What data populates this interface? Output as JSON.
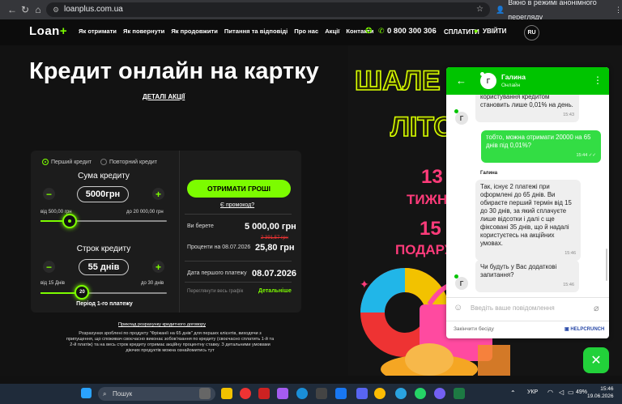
{
  "browser": {
    "url": "loanplus.com.ua",
    "incognito_label": "Вікно в режимі анонімного перегляду"
  },
  "nav": {
    "logo": "Loan",
    "links": [
      "Як отримати",
      "Як повернути",
      "Як продовжити",
      "Питання та відповіді",
      "Про нас",
      "Акції",
      "Контакти"
    ],
    "phone": "0 800 300 306",
    "pay": "СПЛАТИТИ",
    "login": "УВІЙТИ",
    "lang": "RU"
  },
  "hero": {
    "title": "Кредит онлайн на картку",
    "deals_link": "ДЕТАЛІ АКЦІЇ"
  },
  "calculator": {
    "radio_first": "Перший кредит",
    "radio_repeat": "Повторний кредит",
    "amount_label": "Сума кредиту",
    "amount_value": "5000грн",
    "amount_min": "від 500,00 грн",
    "amount_max": "до 20 000,00 грн",
    "amount_fraction": 0.23,
    "term_label": "Строк кредиту",
    "term_value": "55 днів",
    "term_min": "від 15 Днів",
    "term_max": "до 30 днів",
    "term_knob": "20",
    "term_fraction": 0.33,
    "period_label": "Період 1-го платежу",
    "get_money": "ОТРИМАТИ ГРОШІ",
    "promo_code": "Є промокод?",
    "borrow_label": "Ви берете",
    "borrow_value": "5 000,00 грн",
    "interest_old": "2 391,57 грн",
    "interest_label": "Проценти на 08.07.2026",
    "interest_value": "25,80 грн",
    "first_payment_label": "Дата першого платежу",
    "first_payment_value": "08.07.2026",
    "schedule_label": "Переглянути весь графік",
    "details_link": "Детальніше",
    "example_link": "Приклад розрахунку кредитного договору",
    "disclaimer": "Розрахунки зроблені по продукту \"Фріжанії на 65 днів\" для перших клієнтів, виходячи з припущення, що споживач своєчасно виконає зобов'язання по кредиту (своєчасно сплатить 1-й та 2-й платіж) та на весь строк кредиту отримає акційну процентну ставку. З детальними умовами діючих продуктів можна ознайомитись тут"
  },
  "promo": {
    "line1": "ШАЛЕ",
    "line2": "ЛІТО",
    "line3": "13",
    "line4": "ТИЖН",
    "line5": "15",
    "line6": "ПОДАРУ"
  },
  "chat": {
    "agent_name": "Галина",
    "agent_status": "Онлайн",
    "avatar_letter": "Г",
    "messages": [
      {
        "dir": "in",
        "text": "користування кредитом становить лише 0,01% на день.",
        "time": "15:43"
      },
      {
        "dir": "out",
        "text": "тобто, можна отримати 20000 на 65 днів під 0,01%?",
        "time": "15:44"
      },
      {
        "dir": "in",
        "sender": "Галина",
        "text": "Так, існує 2 платежі при оформлені до 65 днів. Ви обираєте перший термін від 15 до 30 днів, за який сплачуєте лише відсотки і далі с ще фіксовані 35 днів, що й надалі користуєтесь на акційних умовах.",
        "time": "15:46"
      },
      {
        "dir": "in",
        "text": "Чи будуть у Вас додаткові запитання?",
        "time": "15:46"
      }
    ],
    "input_placeholder": "Введіть ваше повідомлення",
    "end_chat": "Закінчити бесіду",
    "powered": "HELPCRUNCH"
  },
  "taskbar": {
    "search": "Пошук",
    "lang": "УКР",
    "battery": "49%",
    "time": "15:46",
    "date": "19.06.2026"
  }
}
